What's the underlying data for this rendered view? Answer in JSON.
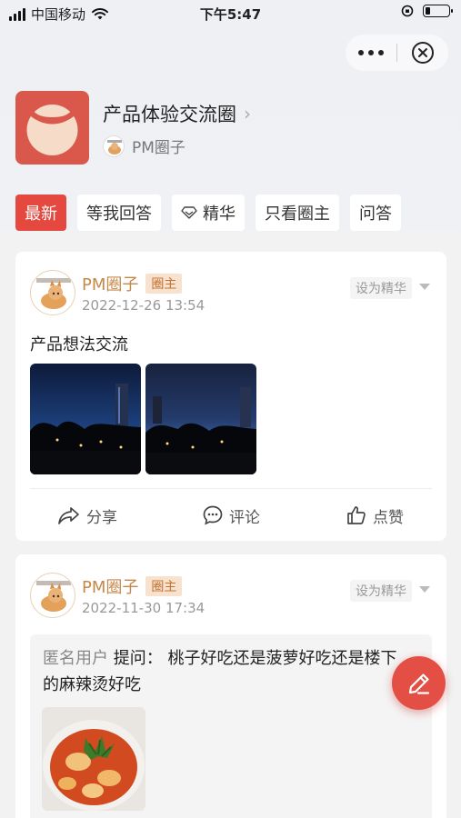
{
  "status": {
    "carrier": "中国移动",
    "time": "下午5:47"
  },
  "circle": {
    "title": "产品体验交流圈",
    "owner": "PM圈子"
  },
  "tabs": [
    {
      "label": "最新",
      "active": true
    },
    {
      "label": "等我回答",
      "active": false
    },
    {
      "label": "精华",
      "active": false,
      "icon": "diamond-icon"
    },
    {
      "label": "只看圈主",
      "active": false
    },
    {
      "label": "问答",
      "active": false
    }
  ],
  "posts": [
    {
      "author": "PM圈子",
      "badge": "圈主",
      "date": "2022-12-26 13:54",
      "set_best": "设为精华",
      "text": "产品想法交流",
      "actions": {
        "share": "分享",
        "comment": "评论",
        "like": "点赞"
      }
    },
    {
      "author": "PM圈子",
      "badge": "圈主",
      "date": "2022-11-30 17:34",
      "set_best": "设为精华",
      "question": {
        "anon": "匿名用户",
        "prefix": "提问：",
        "text": "桃子好吃还是菠萝好吃还是楼下的麻辣烫好吃"
      }
    }
  ],
  "colors": {
    "accent": "#e5483f",
    "owner_name": "#c4884a",
    "badge_bg": "#f7e2cf"
  }
}
